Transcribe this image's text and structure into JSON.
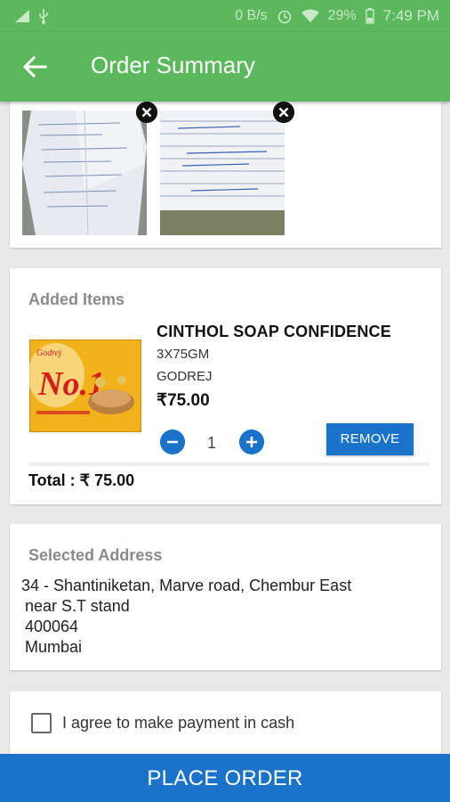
{
  "status_bar": {
    "speed": "0 B/s",
    "battery": "29%",
    "time": "7:49 PM"
  },
  "app_bar": {
    "title": "Order Summary",
    "back_icon": "arrow-back-icon"
  },
  "prescriptions": {
    "images": [
      {
        "icon": "document-photo"
      },
      {
        "icon": "document-photo"
      }
    ],
    "remove_icon": "close-circle-icon"
  },
  "added_items": {
    "label": "Added Items",
    "items": [
      {
        "name": "CINTHOL SOAP CONFIDENCE",
        "size": "3X75GM",
        "brand": "GODREJ",
        "price": "₹75.00",
        "quantity": "1",
        "remove_label": "REMOVE"
      }
    ],
    "total": "Total : ₹ 75.00"
  },
  "address": {
    "label": "Selected Address",
    "lines": [
      "34 - Shantiniketan, Marve road, Chembur East",
      "near S.T stand",
      "400064",
      "Mumbai"
    ]
  },
  "agreement": {
    "text": "I agree to make payment in cash",
    "checked": false
  },
  "place_order_label": "PLACE ORDER",
  "colors": {
    "app_bar": "#5cb85c",
    "accent": "#1a73c8"
  }
}
